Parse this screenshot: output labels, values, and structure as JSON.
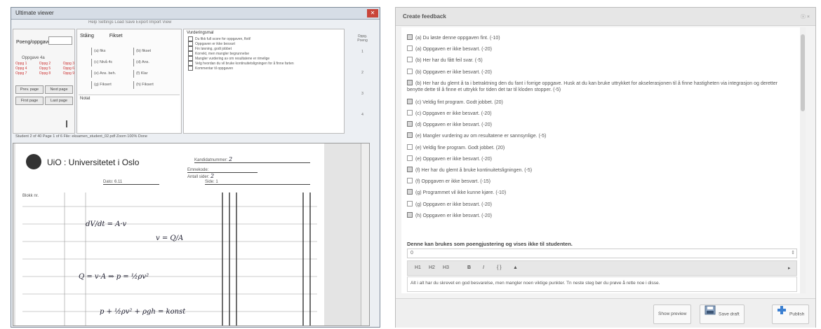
{
  "left": {
    "title": "Ultimate viewer",
    "menu": "Help   Settings   Load   Save   Export   Import   View",
    "mark_label": "Poeng/oppgave",
    "mark_value": "",
    "group_title": "Oppgave 4a",
    "rows": [
      [
        "Oppg 1",
        "Oppg 2",
        "Oppg 3"
      ],
      [
        "Oppg 4",
        "Oppg 5",
        "Oppg 6"
      ],
      [
        "Oppg 7",
        "Oppg 8",
        "Oppg 9"
      ]
    ],
    "btn_prev": "Prev. page",
    "btn_next": "Next page",
    "btn_first": "First page",
    "btn_last": "Last page",
    "tab1": "Ståing",
    "tab2": "Fikset",
    "cells": [
      "(a) fiks",
      "(b) fikset",
      "(c) Nivå 4c",
      "(d) Ans.",
      "(e) Ans. beh.",
      "(f) Klar",
      "(g) Fiksert",
      "(h) Fiksert"
    ],
    "area_label": "Notat",
    "tasks_header": "Vurderingsmal",
    "task_lines": [
      "Du fikk full score for oppgaven, flott!",
      "Oppgaven er ikke besvart",
      "Fin løsning, godt jobbet",
      "Korrekt, men mangler begrunnelse",
      "Mangler vurdering av om resultatene er rimelige",
      "Velg hvordan du vil bruke kontinuitetsligningen for å finne farten",
      "Kommentar til oppgaven"
    ],
    "side": [
      "Oppg.",
      "Poeng",
      "1",
      "2",
      "3",
      "4"
    ],
    "status": "Student 2 of 40   Page 1 of 6   File: eksamen_student_02.pdf   Zoom 100%   Done",
    "uni_name": "UiO : Universitetet i Oslo",
    "f1": "Kandidatnummer:",
    "f1v": "2",
    "f2": "Emnekode: ",
    "f3": "Dato: 6.11",
    "f4": "Side: 1",
    "f5": "Antall sider: ",
    "f5v": "2",
    "sheet_label": "Blokk nr.",
    "hw1": "dV/dt = A·v",
    "hw2": "v = Q/A",
    "hw3": "Q = v·A  ⇒  p = ½ρv²",
    "hw4": "p + ½ρv² + ρgh = konst"
  },
  "dialog": {
    "title": "Create feedback",
    "close": "ⓧ ×",
    "criteria": [
      {
        "checked": true,
        "text": "(a) Du løste denne oppgaven fint. (-10)"
      },
      {
        "checked": false,
        "text": "(a) Oppgaven er ikke besvart. (-20)"
      },
      {
        "checked": false,
        "text": "(b) Her har du fått feil svar. (-5)"
      },
      {
        "checked": false,
        "text": "(b) Oppgaven er ikke besvart. (-20)"
      },
      {
        "checked": true,
        "text": "(b) Her har du glemt å ta i betraktning den du fant i forrige oppgave. Husk at du kan bruke uttrykket for akselerasjonen til å finne hastigheten via integrasjon og deretter benytte dette til å finne et uttrykk for tiden det tar til kloden stopper. (-5)"
      },
      {
        "checked": true,
        "text": "(c) Veldig fint program. Godt jobbet. (20)"
      },
      {
        "checked": false,
        "text": "(c) Oppgaven er ikke besvart. (-20)"
      },
      {
        "checked": true,
        "text": "(d) Oppgaven er ikke besvart. (-20)"
      },
      {
        "checked": true,
        "text": "(e) Mangler vurdering av om resultatene er sannsynlige. (-5)"
      },
      {
        "checked": false,
        "text": "(e) Veldig fine program. Godt jobbet. (20)"
      },
      {
        "checked": false,
        "text": "(e) Oppgaven er ikke besvart. (-20)"
      },
      {
        "checked": true,
        "text": "(f) Her har du glemt å bruke kontinuitetsligningen. (-5)"
      },
      {
        "checked": false,
        "text": "(f) Oppgaven er ikke besvart. (-15)"
      },
      {
        "checked": true,
        "text": "(g) Programmet vil ikke kunne kjøre. (-10)"
      },
      {
        "checked": false,
        "text": "(g) Oppgaven er ikke besvart. (-20)"
      },
      {
        "checked": true,
        "text": "(h) Oppgaven er ikke besvart. (-20)"
      }
    ],
    "note": "Denne kan brukes som poengjustering og vises ikke til studenten.",
    "points_value": "0",
    "toolbar": {
      "h1": "H1",
      "h2": "H2",
      "h3": "H3",
      "bold": "B",
      "italic": "I",
      "link": "{ }",
      "img": "▲",
      "more": "▸"
    },
    "feedback_text": "Alt i alt har du skrevet en god besvarelse, men mangler noen viktige punkter. Tn neste steg bør du prøve å rette noe i disse.",
    "buttons": {
      "preview": "Show preview",
      "draft": "Save draft",
      "publish": "Publish"
    }
  }
}
